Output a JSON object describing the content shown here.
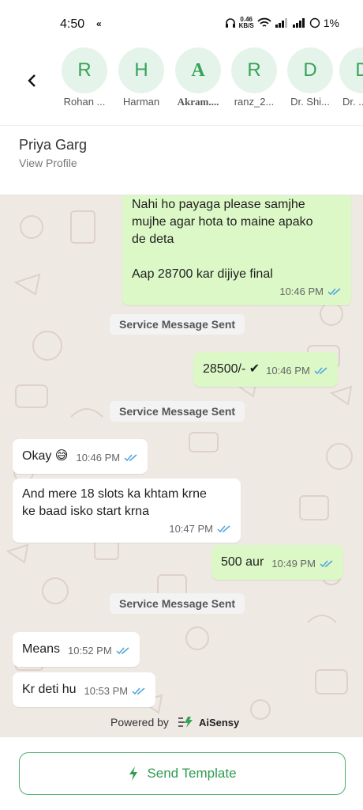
{
  "status_bar": {
    "time": "4:50",
    "extra": "«",
    "net_speed_value": "0.46",
    "net_speed_unit": "KB/S",
    "battery": "1%"
  },
  "contacts": [
    {
      "initial": "R",
      "name": "Rohan ..."
    },
    {
      "initial": "H",
      "name": "Harman"
    },
    {
      "initial": "A",
      "name": "Akram...."
    },
    {
      "initial": "R",
      "name": "ranz_2..."
    },
    {
      "initial": "D",
      "name": "Dr. Shi..."
    },
    {
      "initial": "D",
      "name": "Dr. ..."
    }
  ],
  "chat_header": {
    "name": "Priya Garg",
    "subtitle": "View Profile"
  },
  "messages": [
    {
      "direction": "out",
      "text": "Nahi ho payaga please samjhe\nmujhe agar hota to maine apako\nde deta\n\nAap 28700 kar dijiye final",
      "time": "10:46 PM"
    },
    {
      "direction": "system",
      "text": "Service Message Sent"
    },
    {
      "direction": "out",
      "text": "28500/- ✔",
      "time": "10:46 PM"
    },
    {
      "direction": "system",
      "text": "Service Message Sent"
    },
    {
      "direction": "in",
      "text": "Okay 😅",
      "time": "10:46 PM"
    },
    {
      "direction": "in",
      "text": "And mere 18 slots ka khtam krne\nke baad isko start krna",
      "time": "10:47 PM"
    },
    {
      "direction": "out",
      "text": "500 aur",
      "time": "10:49 PM"
    },
    {
      "direction": "system",
      "text": "Service Message Sent"
    },
    {
      "direction": "in",
      "text": "Means",
      "time": "10:52 PM"
    },
    {
      "direction": "in",
      "text": "Kr deti hu",
      "time": "10:53 PM"
    }
  ],
  "powered_by": {
    "label": "Powered by",
    "brand": "AiSensy"
  },
  "bottom": {
    "send_template_label": "Send Template"
  },
  "colors": {
    "accent": "#36a35a",
    "outgoing_bubble": "#dcf8c6",
    "incoming_bubble": "#ffffff",
    "chat_background": "#efe9e4",
    "tick": "#4fa3e0"
  }
}
